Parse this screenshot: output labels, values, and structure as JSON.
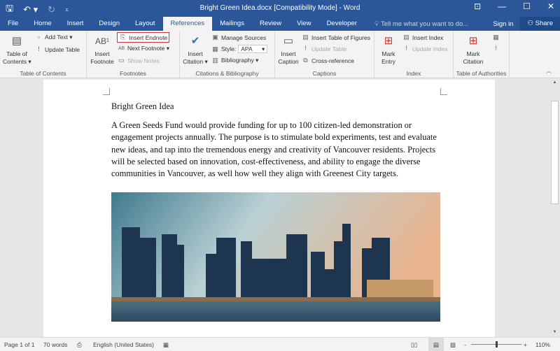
{
  "titlebar": {
    "title": "Bright Green Idea.docx [Compatibility Mode] - Word",
    "qat": [
      {
        "icon": "save-icon",
        "glyph": "🖫"
      },
      {
        "icon": "undo-icon",
        "glyph": "↶ ▾"
      },
      {
        "icon": "redo-icon",
        "glyph": "↻"
      },
      {
        "icon": "customize-qat-icon",
        "glyph": "⩡"
      }
    ],
    "window_controls": [
      {
        "icon": "ribbon-display-icon",
        "glyph": "⊡"
      },
      {
        "icon": "minimize-icon",
        "glyph": "—"
      },
      {
        "icon": "maximize-icon",
        "glyph": "☐"
      },
      {
        "icon": "close-icon",
        "glyph": "✕"
      }
    ]
  },
  "tabs": [
    "File",
    "Home",
    "Insert",
    "Design",
    "Layout",
    "References",
    "Mailings",
    "Review",
    "View",
    "Developer"
  ],
  "active_tab": "References",
  "tell_me": "Tell me what you want to do...",
  "sign_in": "Sign in",
  "share": "Share",
  "ribbon": {
    "toc": {
      "label": "Table of Contents",
      "toc_button": "Table of\nContents ▾",
      "add_text": "Add Text ▾",
      "update_table": "Update Table"
    },
    "footnotes": {
      "label": "Footnotes",
      "insert_footnote": "Insert\nFootnote",
      "insert_endnote": "Insert Endnote",
      "next_footnote": "Next Footnote ▾",
      "show_notes": "Show Notes"
    },
    "citations": {
      "label": "Citations & Bibliography",
      "insert_citation": "Insert\nCitation ▾",
      "manage_sources": "Manage Sources",
      "style_label": "Style:",
      "style_value": "APA",
      "bibliography": "Bibliography ▾"
    },
    "captions": {
      "label": "Captions",
      "insert_caption": "Insert\nCaption",
      "insert_table_of_figures": "Insert Table of Figures",
      "update_table": "Update Table",
      "cross_reference": "Cross-reference"
    },
    "index": {
      "label": "Index",
      "mark_entry": "Mark\nEntry",
      "insert_index": "Insert Index",
      "update_index": "Update Index"
    },
    "toa": {
      "label": "Table of Authorities",
      "mark_citation": "Mark\nCitation"
    }
  },
  "document": {
    "heading": "Bright Green Idea",
    "paragraph": "A Green Seeds Fund would provide funding for up to 100 citizen-led demonstration or engagement projects annually. The purpose is to stimulate bold experiments, test and evaluate new ideas, and tap into the tremendous energy and creativity of Vancouver residents. Projects will be selected based on innovation, cost-effectiveness, and ability to engage the diverse communities in Vancouver, as well how well they align with Greenest City targets.",
    "image": "city-skyline-photo"
  },
  "status": {
    "page": "Page 1 of 1",
    "words": "70 words",
    "language": "English (United States)",
    "zoom": "110%",
    "zoom_minus": "-",
    "zoom_plus": "+"
  }
}
